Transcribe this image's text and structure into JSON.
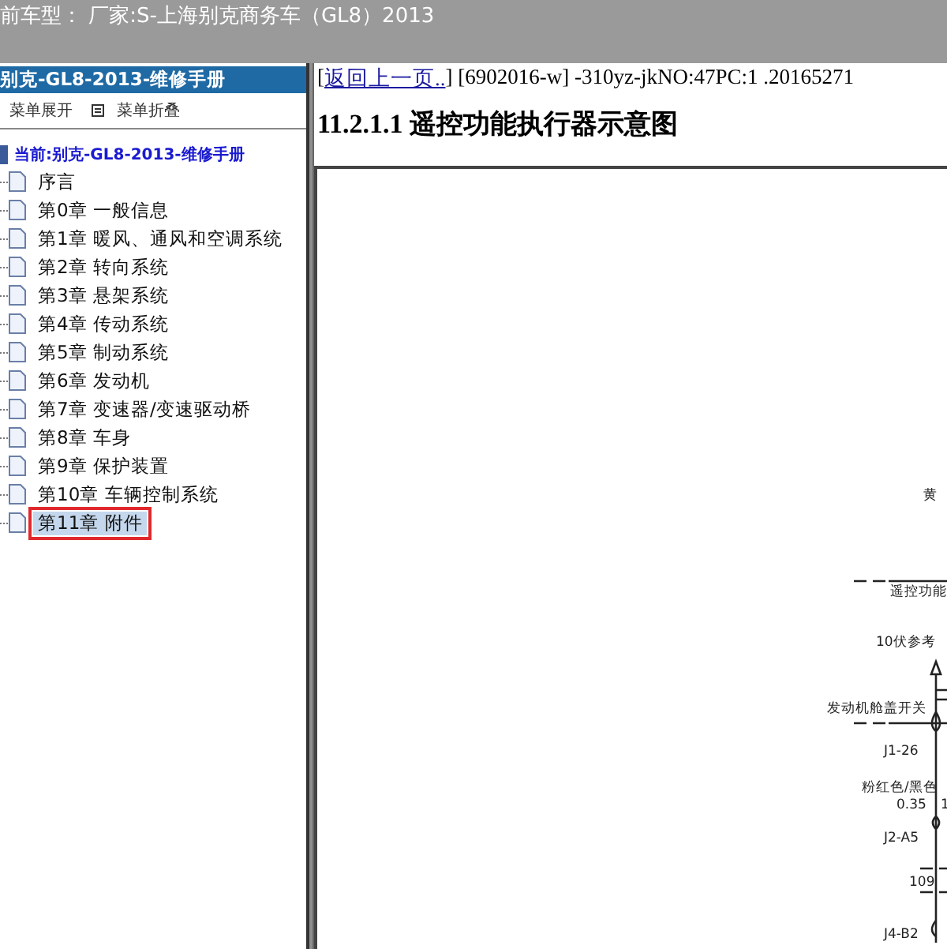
{
  "title_bar": {
    "text": "前车型： 厂家:S-上海别克商务车（GL8）2013"
  },
  "sidebar": {
    "header": "别克-GL8-2013-维修手册",
    "toolbar": [
      {
        "kind": "expand",
        "label": "菜单展开"
      },
      {
        "kind": "collapse",
        "label": "菜单折叠"
      }
    ],
    "root": "当前:别克-GL8-2013-维修手册",
    "items": [
      {
        "label": "序言",
        "selected": false
      },
      {
        "label": "第0章 一般信息",
        "selected": false
      },
      {
        "label": "第1章 暖风、通风和空调系统",
        "selected": false
      },
      {
        "label": "第2章 转向系统",
        "selected": false
      },
      {
        "label": "第3章 悬架系统",
        "selected": false
      },
      {
        "label": "第4章 传动系统",
        "selected": false
      },
      {
        "label": "第5章 制动系统",
        "selected": false
      },
      {
        "label": "第6章 发动机",
        "selected": false
      },
      {
        "label": "第7章 变速器/变速驱动桥",
        "selected": false
      },
      {
        "label": "第8章 车身",
        "selected": false
      },
      {
        "label": "第9章 保护装置",
        "selected": false
      },
      {
        "label": "第10章 车辆控制系统",
        "selected": false
      },
      {
        "label": "第11章 附件",
        "selected": true
      }
    ]
  },
  "content": {
    "open_bracket": "[",
    "back_link": "返回上一页..",
    "meta": "] [6902016-w] -310yz-jkNO:47PC:1 .20165271",
    "heading": "11.2.1.1 遥控功能执行器示意图",
    "diagram_labels": [
      {
        "kind": "top",
        "text": "黄"
      },
      {
        "kind": "section",
        "text": "遥控功能"
      },
      {
        "kind": "supply",
        "text": "10伏参考"
      },
      {
        "kind": "switch",
        "text": "发动机舱盖开关"
      },
      {
        "kind": "pin1",
        "text": "J1-26"
      },
      {
        "kind": "wire",
        "text": "粉红色/黑色"
      },
      {
        "kind": "gauge",
        "text": "0.35"
      },
      {
        "kind": "gauge2",
        "text": "1"
      },
      {
        "kind": "pin2",
        "text": "J2-A5"
      },
      {
        "kind": "splice",
        "text": "109"
      },
      {
        "kind": "pin3",
        "text": "J4-B2"
      }
    ]
  }
}
